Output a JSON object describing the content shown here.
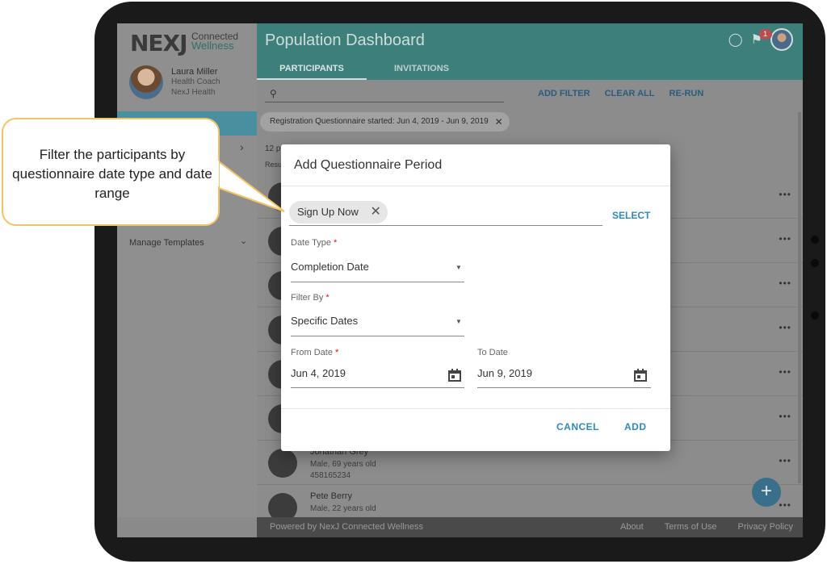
{
  "logo": {
    "mark": "NEXJ",
    "line1": "Connected",
    "line2": "Wellness"
  },
  "profile": {
    "name": "Laura Miller",
    "role": "Health Coach",
    "org": "NexJ Health"
  },
  "sidebar": {
    "manage_templates": "Manage Templates"
  },
  "header": {
    "title": "Population Dashboard",
    "notification_count": "1"
  },
  "tabs": [
    {
      "label": "PARTICIPANTS"
    },
    {
      "label": "INVITATIONS"
    }
  ],
  "toolbar": {
    "add_filter": "ADD FILTER",
    "clear_all": "CLEAR ALL",
    "rerun": "RE-RUN"
  },
  "active_filter": "Registration Questionnaire started: Jun 4, 2019 - Jun 9, 2019",
  "results": {
    "count_prefix": "12 p",
    "label_prefix": "Resu"
  },
  "rows": [
    {
      "name": "Jonathan Grey",
      "info": "Male, 69 years old",
      "id": "458165234"
    },
    {
      "name": "Pete Berry",
      "info": "Male, 22 years old",
      "id": ""
    }
  ],
  "footer": {
    "powered": "Powered by NexJ Connected Wellness",
    "about": "About",
    "terms": "Terms of Use",
    "privacy": "Privacy Policy"
  },
  "modal": {
    "title": "Add Questionnaire Period",
    "questionnaire_chip": "Sign Up Now",
    "select_label": "SELECT",
    "date_type": {
      "label": "Date Type",
      "value": "Completion Date"
    },
    "filter_by": {
      "label": "Filter By",
      "value": "Specific Dates"
    },
    "from_date": {
      "label": "From Date",
      "value": "Jun 4, 2019"
    },
    "to_date": {
      "label": "To Date",
      "value": "Jun 9, 2019"
    },
    "cancel": "CANCEL",
    "add": "ADD"
  },
  "callout": {
    "text": "Filter the participants by questionnaire date type and date range"
  },
  "colors": {
    "header": "#3d7f7a",
    "accent": "#2f8ab8",
    "callout_border": "#f2c464"
  }
}
